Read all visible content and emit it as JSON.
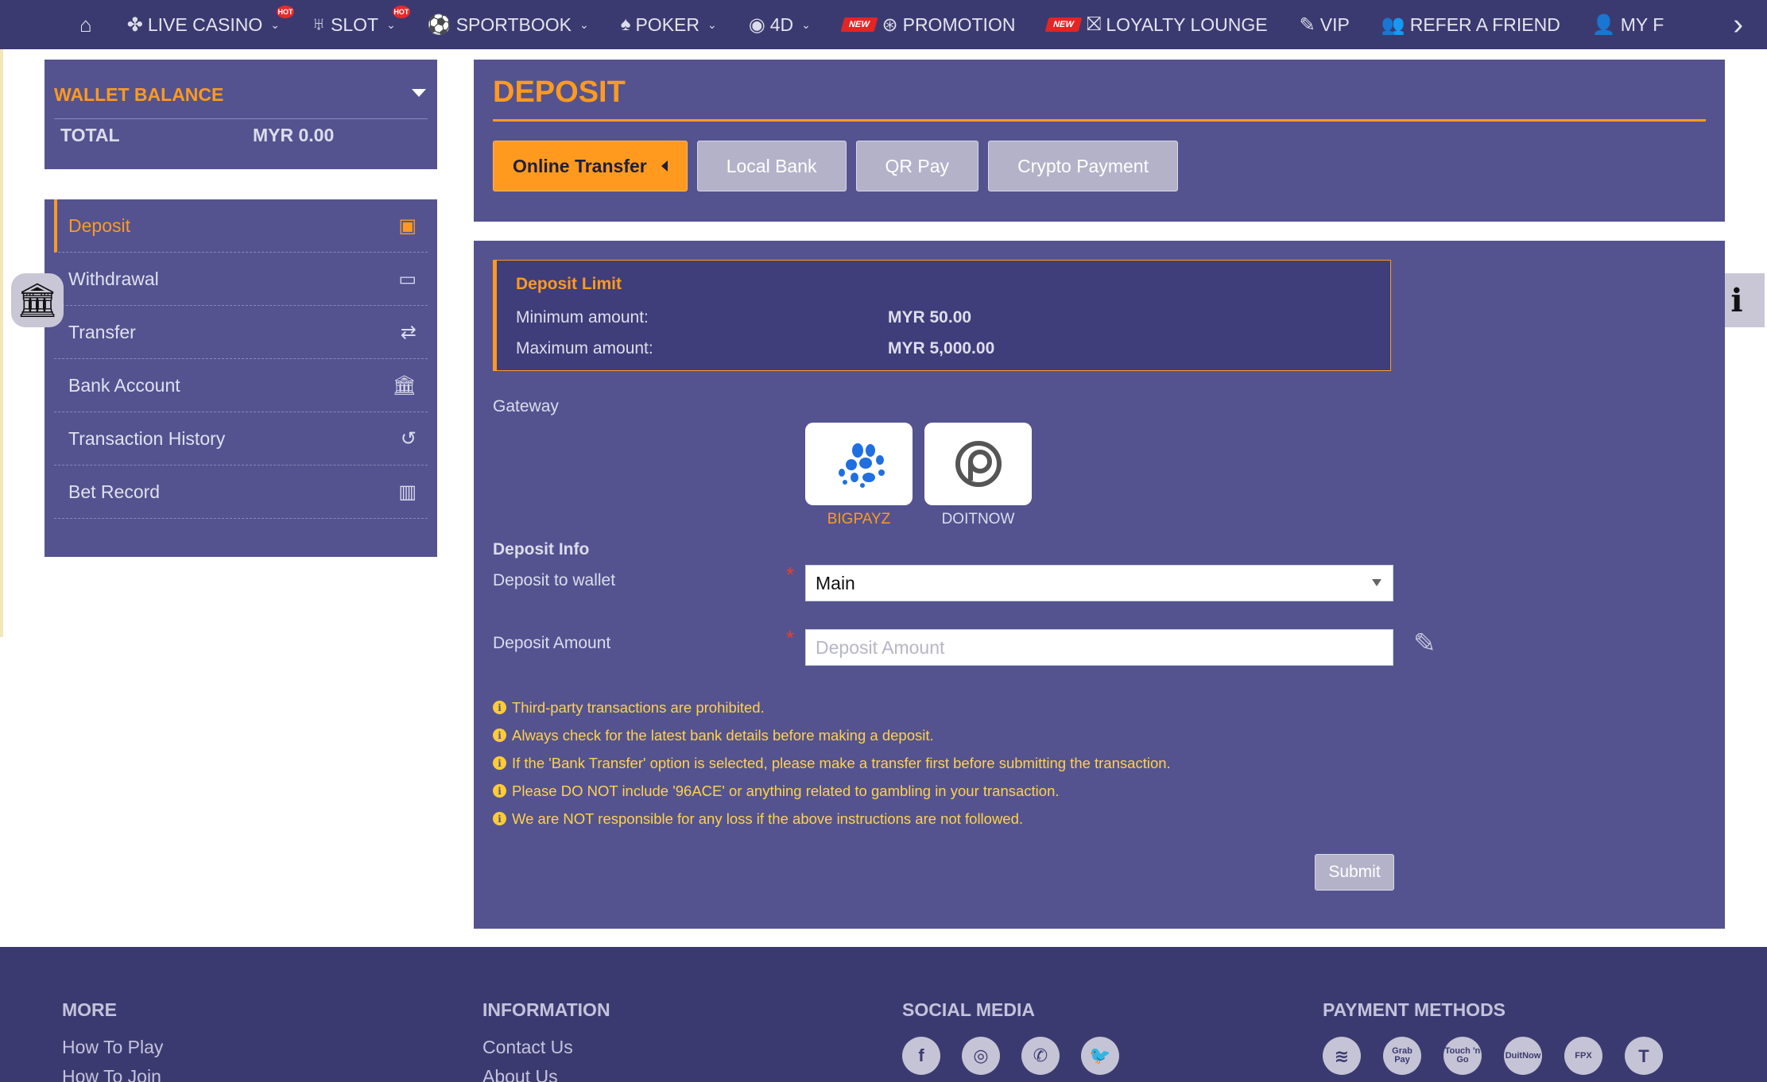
{
  "nav": {
    "items": [
      {
        "label": "LIVE CASINO",
        "icon": "cards-icon",
        "glyph": "✤",
        "dropdown": true,
        "badge": "HOT"
      },
      {
        "label": "SLOT",
        "icon": "slot-icon",
        "glyph": "♅",
        "dropdown": true,
        "badge": "HOT"
      },
      {
        "label": "SPORTBOOK",
        "icon": "soccer-ball-icon",
        "glyph": "⚽",
        "dropdown": true,
        "badge": ""
      },
      {
        "label": "POKER",
        "icon": "poker-icon",
        "glyph": "♠",
        "dropdown": true,
        "badge": ""
      },
      {
        "label": "4D",
        "icon": "lottery-icon",
        "glyph": "◉",
        "dropdown": true,
        "badge": ""
      },
      {
        "label": "PROMOTION",
        "icon": "promotion-icon",
        "glyph": "⊛",
        "dropdown": false,
        "badge": "NEW"
      },
      {
        "label": "LOYALTY LOUNGE",
        "icon": "gift-icon",
        "glyph": "⛝",
        "dropdown": false,
        "badge": "NEW"
      },
      {
        "label": "VIP",
        "icon": "vip-tag-icon",
        "glyph": "✎",
        "dropdown": false,
        "badge": ""
      },
      {
        "label": "REFER A FRIEND",
        "icon": "users-icon",
        "glyph": "👥",
        "dropdown": false,
        "badge": ""
      },
      {
        "label": "MY F",
        "icon": "user-icon",
        "glyph": "👤",
        "dropdown": false,
        "badge": ""
      }
    ]
  },
  "wallet": {
    "title": "WALLET BALANCE",
    "total_label": "TOTAL",
    "total_value": "MYR 0.00"
  },
  "sidebar": {
    "items": [
      {
        "label": "Deposit",
        "icon": "cash-icon",
        "glyph": "▣",
        "active": true
      },
      {
        "label": "Withdrawal",
        "icon": "credit-card-icon",
        "glyph": "▭",
        "active": false
      },
      {
        "label": "Transfer",
        "icon": "transfer-arrows-icon",
        "glyph": "⇄",
        "active": false
      },
      {
        "label": "Bank Account",
        "icon": "bank-icon",
        "glyph": "🏛",
        "active": false
      },
      {
        "label": "Transaction History",
        "icon": "history-icon",
        "glyph": "↺",
        "active": false
      },
      {
        "label": "Bet Record",
        "icon": "bar-chart-icon",
        "glyph": "▥",
        "active": false
      }
    ]
  },
  "deposit": {
    "title": "DEPOSIT",
    "tabs": [
      {
        "label": "Online Transfer",
        "active": true
      },
      {
        "label": "Local Bank",
        "active": false
      },
      {
        "label": "QR Pay",
        "active": false
      },
      {
        "label": "Crypto Payment",
        "active": false
      }
    ],
    "limit": {
      "title": "Deposit Limit",
      "min_label": "Minimum amount:",
      "min_value": "MYR 50.00",
      "max_label": "Maximum amount:",
      "max_value": "MYR 5,000.00"
    },
    "gateway_label": "Gateway",
    "gateways": [
      {
        "name": "BIGPAYZ",
        "selected": true
      },
      {
        "name": "DOITNOW",
        "selected": false
      }
    ],
    "info_label": "Deposit Info",
    "wallet_label": "Deposit to wallet",
    "wallet_value": "Main",
    "amount_label": "Deposit Amount",
    "amount_placeholder": "Deposit Amount",
    "notes": [
      "Third-party transactions are prohibited.",
      "Always check for the latest bank details before making a deposit.",
      "If the 'Bank Transfer' option is selected, please make a transfer first before submitting the transaction.",
      "Please DO NOT include '96ACE' or anything related to gambling in your transaction.",
      "We are NOT responsible for any loss if the above instructions are not followed."
    ],
    "submit_label": "Submit"
  },
  "footer": {
    "more": {
      "title": "MORE",
      "links": [
        "How To Play",
        "How To Join"
      ]
    },
    "information": {
      "title": "INFORMATION",
      "links": [
        "Contact Us",
        "About Us"
      ]
    },
    "social": {
      "title": "SOCIAL MEDIA",
      "icons": [
        {
          "icon": "facebook-icon",
          "glyph": "f"
        },
        {
          "icon": "instagram-icon",
          "glyph": "◎"
        },
        {
          "icon": "whatsapp-icon",
          "glyph": "✆"
        },
        {
          "icon": "twitter-icon",
          "glyph": "🐦"
        }
      ]
    },
    "payment": {
      "title": "PAYMENT METHODS",
      "icons": [
        {
          "icon": "bank-transfer-icon",
          "text": "≋"
        },
        {
          "icon": "grabpay-icon",
          "text": "Grab Pay"
        },
        {
          "icon": "touch-n-go-icon",
          "text": "Touch 'n Go"
        },
        {
          "icon": "duitnow-icon",
          "text": "DuitNow"
        },
        {
          "icon": "fpx-icon",
          "text": "FPX"
        },
        {
          "icon": "tether-icon",
          "text": "T"
        }
      ]
    }
  },
  "colors": {
    "accent": "#ff9a1f",
    "panel": "#545390",
    "nav": "#3b3a70"
  }
}
